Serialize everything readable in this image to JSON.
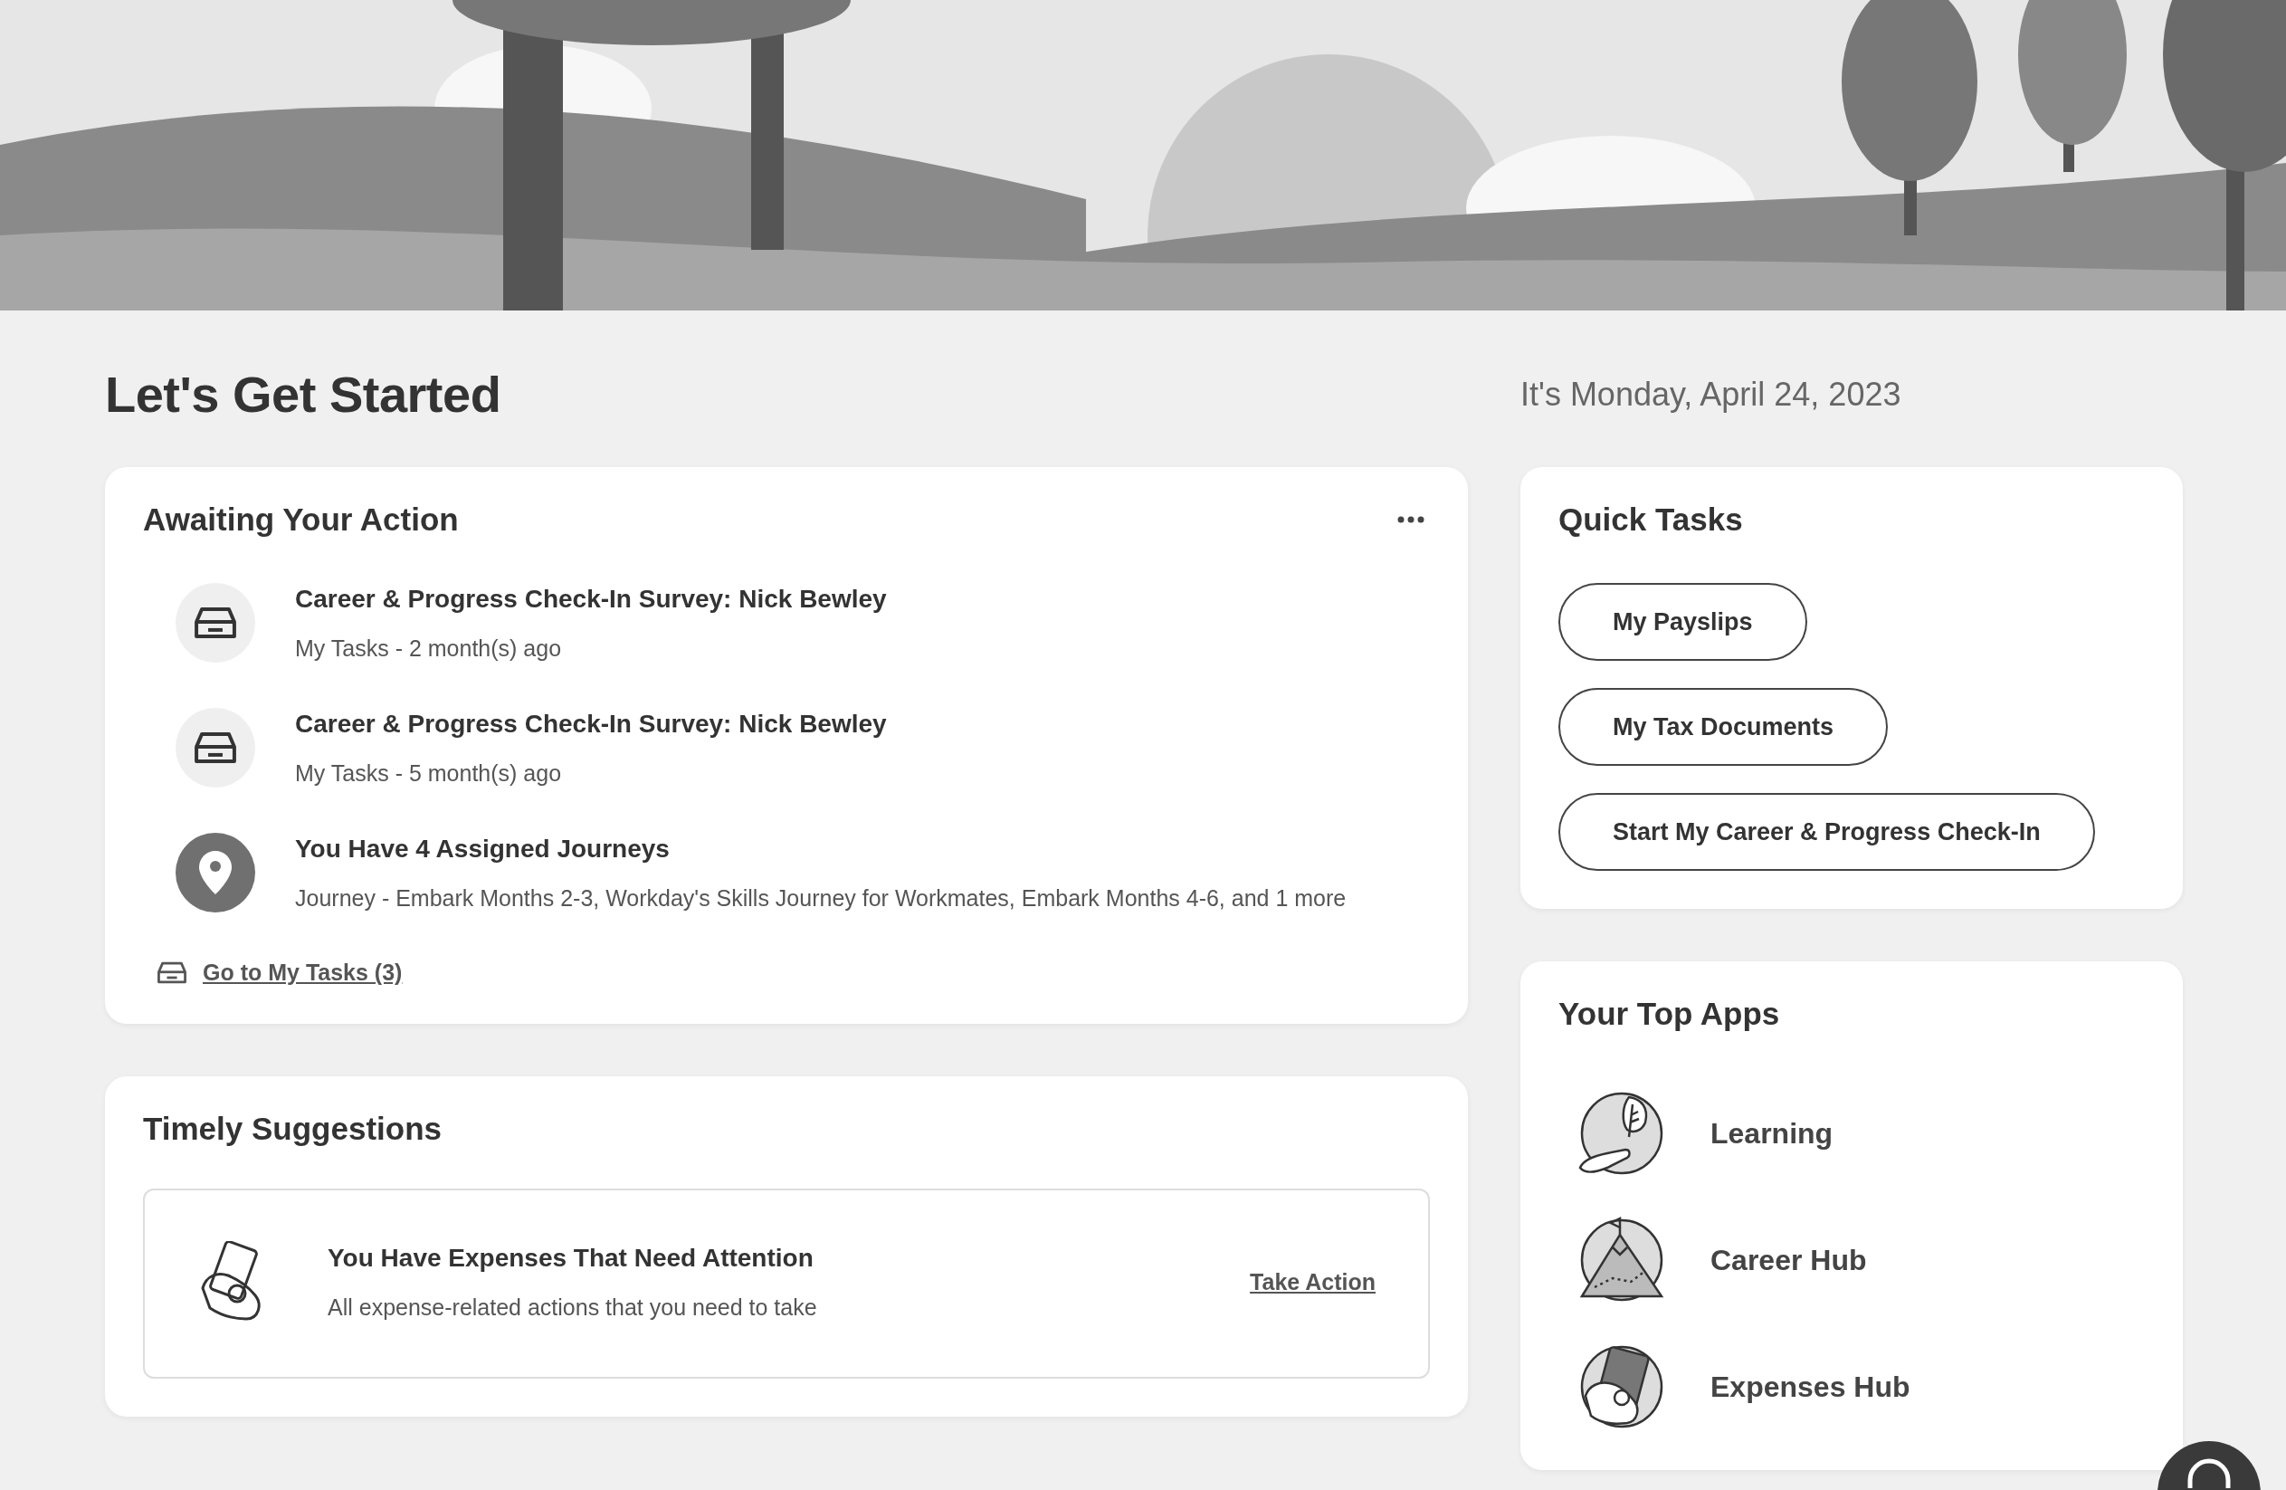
{
  "header": {
    "title": "Let's Get Started",
    "date": "It's Monday, April 24, 2023"
  },
  "awaiting": {
    "title": "Awaiting Your Action",
    "items": [
      {
        "kind": "task",
        "title": "Career & Progress Check-In Survey: Nick Bewley",
        "subtitle": "My Tasks - 2 month(s) ago"
      },
      {
        "kind": "task",
        "title": "Career & Progress Check-In Survey: Nick Bewley",
        "subtitle": "My Tasks - 5 month(s) ago"
      },
      {
        "kind": "journey",
        "title": "You Have 4 Assigned Journeys",
        "subtitle": "Journey - Embark Months 2-3, Workday's Skills Journey for Workmates, Embark Months 4-6, and 1 more"
      }
    ],
    "link": "Go to My Tasks (3)"
  },
  "suggestions": {
    "title": "Timely Suggestions",
    "items": [
      {
        "title": "You Have Expenses That Need Attention",
        "description": "All expense-related actions that you need to take",
        "action": "Take Action"
      }
    ]
  },
  "quick_tasks": {
    "title": "Quick Tasks",
    "buttons": [
      "My Payslips",
      "My Tax Documents",
      "Start My Career & Progress Check-In"
    ]
  },
  "top_apps": {
    "title": "Your Top Apps",
    "apps": [
      {
        "kind": "learning",
        "label": "Learning"
      },
      {
        "kind": "career",
        "label": "Career Hub"
      },
      {
        "kind": "expenses",
        "label": "Expenses Hub"
      }
    ]
  }
}
